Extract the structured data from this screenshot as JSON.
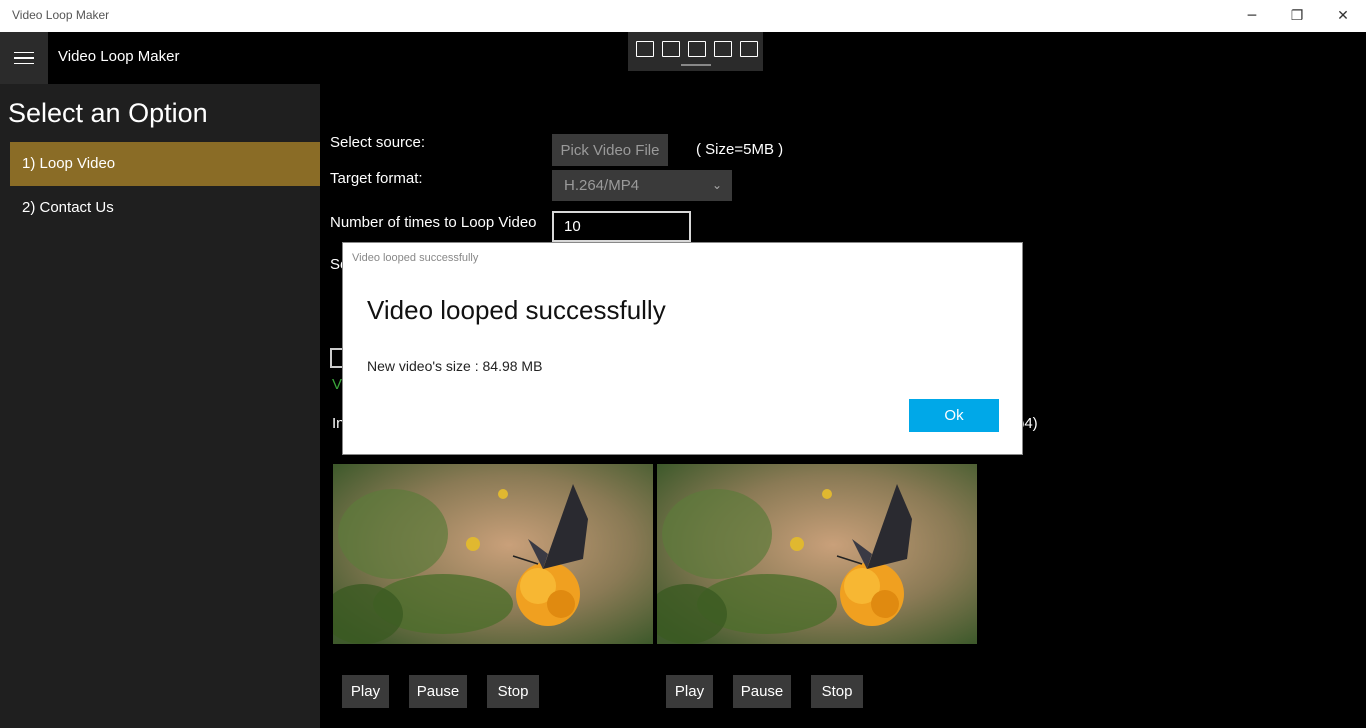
{
  "window": {
    "title": "Video Loop Maker",
    "minimize_icon": "─",
    "maximize_icon": "❐",
    "close_icon": "✕"
  },
  "app": {
    "title": "Video Loop Maker"
  },
  "sidebar": {
    "heading": "Select an Option",
    "items": [
      {
        "label": "1) Loop Video",
        "active": true
      },
      {
        "label": "2) Contact Us",
        "active": false
      }
    ]
  },
  "form": {
    "select_source_label": "Select source:",
    "pick_button": "Pick Video File",
    "size_label": "( Size=5MB )",
    "target_format_label": "Target format:",
    "target_format_value": "H.264/MP4",
    "loop_count_label": "Number of times to Loop Video",
    "loop_count_value": "10",
    "partial_label_1": "Se",
    "partial_label_2": "V",
    "partial_label_3": "In",
    "partial_label_4": "p4)"
  },
  "players": [
    {
      "play": "Play",
      "pause": "Pause",
      "stop": "Stop"
    },
    {
      "play": "Play",
      "pause": "Pause",
      "stop": "Stop"
    }
  ],
  "dialog": {
    "window_title": "Video looped successfully",
    "heading": "Video looped successfully",
    "body": "New video's size : 84.98 MB",
    "ok_button": "Ok"
  },
  "colors": {
    "accent_nav": "#8a6c26",
    "ok_button": "#00a8e8",
    "status_green": "#3aa53a"
  }
}
